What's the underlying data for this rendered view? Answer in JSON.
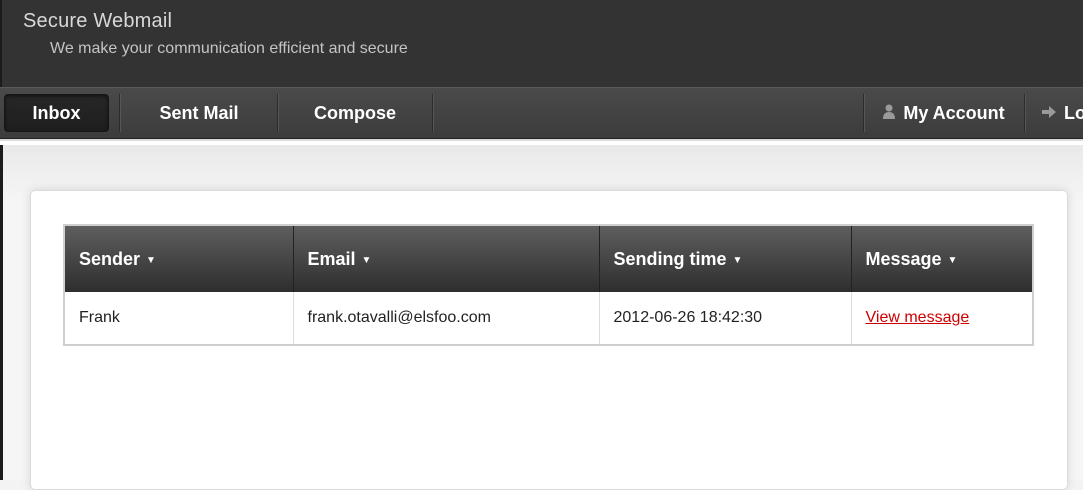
{
  "header": {
    "title": "Secure Webmail",
    "tagline": "We make your communication efficient and secure"
  },
  "nav": {
    "items": [
      {
        "label": "Inbox",
        "active": true
      },
      {
        "label": "Sent Mail"
      },
      {
        "label": "Compose"
      }
    ],
    "right_items": [
      {
        "label": "My Account",
        "icon": "user-icon"
      },
      {
        "label": "Lo",
        "icon": "arrow-right-icon"
      }
    ]
  },
  "table": {
    "columns": [
      "Sender",
      "Email",
      "Sending time",
      "Message"
    ],
    "rows": [
      {
        "sender": "Frank",
        "email": "frank.otavalli@elsfoo.com",
        "time": "2012-06-26 18:42:30",
        "message": "View message"
      }
    ]
  },
  "colors": {
    "header_bg": "#333333",
    "link": "#cc0000"
  }
}
